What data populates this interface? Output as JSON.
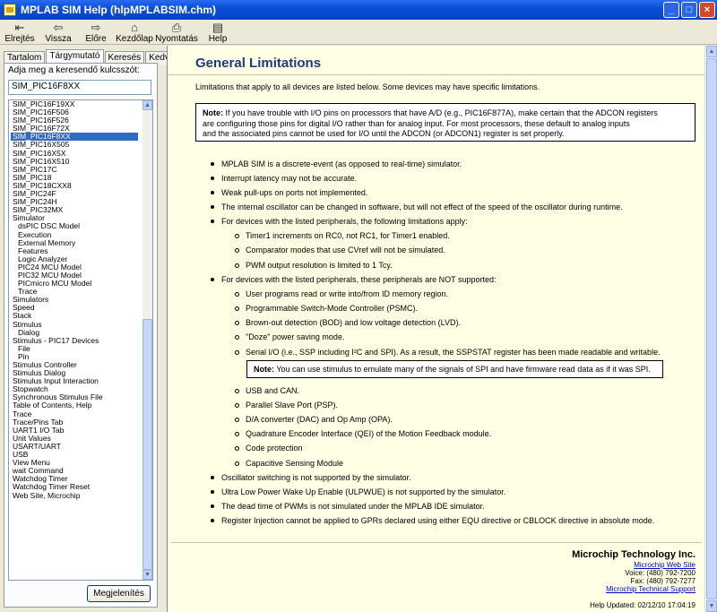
{
  "window": {
    "title": "MPLAB SIM Help (hlpMPLABSIM.chm)",
    "minimize": "_",
    "maximize": "□",
    "close": "×"
  },
  "toolbar": [
    {
      "label": "Elrejtés",
      "glyph": "⇤",
      "icon": "hide-icon"
    },
    {
      "label": "Vissza",
      "glyph": "⇦",
      "icon": "back-icon"
    },
    {
      "label": "Előre",
      "glyph": "⇨",
      "icon": "forward-icon"
    },
    {
      "label": "Kezdőlap",
      "glyph": "⌂",
      "icon": "home-icon"
    },
    {
      "label": "Nyomtatás",
      "glyph": "⎙",
      "icon": "print-icon"
    },
    {
      "label": "Help",
      "glyph": "▤",
      "icon": "help-icon"
    }
  ],
  "nav": {
    "tabs": [
      "Tartalom",
      "Tárgymutató",
      "Keresés",
      "Kedvencek"
    ],
    "active_tab": 1,
    "keyword_label": "Adja meg a keresendő kulcsszót:",
    "keyword_value": "SIM_PIC16F8XX",
    "show_button": "Megjelenítés",
    "index_items": [
      {
        "text": "SIM_PIC16F19XX",
        "level": 0
      },
      {
        "text": "SIM_PIC16F506",
        "level": 0
      },
      {
        "text": "SIM_PIC16F526",
        "level": 0
      },
      {
        "text": "SIM_PIC16F72X",
        "level": 0
      },
      {
        "text": "SIM_PIC16F8XX",
        "level": 0,
        "selected": true
      },
      {
        "text": "SIM_PIC16X505",
        "level": 0
      },
      {
        "text": "SIM_PIC16X5X",
        "level": 0
      },
      {
        "text": "SIM_PIC16X510",
        "level": 0
      },
      {
        "text": "SIM_PIC17C",
        "level": 0
      },
      {
        "text": "SIM_PIC18",
        "level": 0
      },
      {
        "text": "SIM_PIC18CXX8",
        "level": 0
      },
      {
        "text": "SIM_PIC24F",
        "level": 0
      },
      {
        "text": "SIM_PIC24H",
        "level": 0
      },
      {
        "text": "SIM_PIC32MX",
        "level": 0
      },
      {
        "text": "Simulator",
        "level": 0
      },
      {
        "text": "dsPIC DSC Model",
        "level": 1
      },
      {
        "text": "Execution",
        "level": 1
      },
      {
        "text": "External Memory",
        "level": 1
      },
      {
        "text": "Features",
        "level": 1
      },
      {
        "text": "Logic Analyzer",
        "level": 1
      },
      {
        "text": "PIC24 MCU Model",
        "level": 1
      },
      {
        "text": "PIC32 MCU Model",
        "level": 1
      },
      {
        "text": "PICmicro MCU Model",
        "level": 1
      },
      {
        "text": "Trace",
        "level": 1
      },
      {
        "text": "Simulators",
        "level": 0
      },
      {
        "text": "Speed",
        "level": 0
      },
      {
        "text": "Stack",
        "level": 0
      },
      {
        "text": "Stimulus",
        "level": 0
      },
      {
        "text": "Dialog",
        "level": 1
      },
      {
        "text": "Stimulus - PIC17 Devices",
        "level": 0
      },
      {
        "text": "File",
        "level": 1
      },
      {
        "text": "Pin",
        "level": 1
      },
      {
        "text": "Stimulus Controller",
        "level": 0
      },
      {
        "text": "Stimulus Dialog",
        "level": 0
      },
      {
        "text": "Stimulus Input Interaction",
        "level": 0
      },
      {
        "text": "Stopwatch",
        "level": 0
      },
      {
        "text": "Synchronous Stimulus File",
        "level": 0
      },
      {
        "text": "Table of Contents, Help",
        "level": 0
      },
      {
        "text": "Trace",
        "level": 0
      },
      {
        "text": "Trace/Pins Tab",
        "level": 0
      },
      {
        "text": "UART1 I/O Tab",
        "level": 0
      },
      {
        "text": "Unit Values",
        "level": 0
      },
      {
        "text": "USART/UART",
        "level": 0
      },
      {
        "text": "USB",
        "level": 0
      },
      {
        "text": "View Menu",
        "level": 0
      },
      {
        "text": "wait Command",
        "level": 0
      },
      {
        "text": "Watchdog Timer",
        "level": 0
      },
      {
        "text": "Watchdog Timer Reset",
        "level": 0
      },
      {
        "text": "Web Site, Microchip",
        "level": 0
      }
    ]
  },
  "page": {
    "title": "General Limitations",
    "intro": "Limitations that apply to all devices are listed below. Some devices may have specific limitations.",
    "note_label": "Note:",
    "note_lines": [
      "If you have trouble with I/O pins on processors that have A/D (e.g., PIC16F877A), make certain that the ADCON registers",
      "are configuring those pins for digital I/O rather than for analog input. For most processors, these default to analog inputs",
      "and the associated pins cannot be used for I/O until the ADCON (or ADCON1) register is set properly."
    ],
    "bullets_top": [
      "MPLAB SIM is a discrete-event (as opposed to real-time) simulator.",
      "Interrupt latency may not be accurate.",
      "Weak pull-ups on ports not implemented.",
      "The internal oscillator can be changed in software, but will not effect of the speed of the oscillator during runtime.",
      "For devices with the listed peripherals, the following limitations apply:"
    ],
    "sub_bullets_1": [
      "Timer1 increments on RC0, not RC1, for Timer1 enabled.",
      "Comparator modes that use CVref will not be simulated.",
      "PWM output resolution is limited to 1 Tcy."
    ],
    "bullet_not_supported": "For devices with the listed peripherals, these peripherals are NOT supported:",
    "sub_bullets_2a": [
      "User programs read or write into/from ID memory region.",
      "Programmable Switch-Mode Controller (PSMC).",
      "Brown-out detection (BOD) and low voltage detection (LVD).",
      "\"Doze\" power saving mode.",
      "Serial I/O (i.e., SSP including I²C and SPI). As a result, the SSPSTAT register has been made readable and writable."
    ],
    "note2_label": "Note:",
    "note2_text": "You can use stimulus to emulate many of the signals of SPI and have firmware read data as if it was SPI.",
    "sub_bullets_2b": [
      "USB and CAN.",
      "Parallel Slave Port (PSP).",
      "D/A converter (DAC) and Op Amp (OPA).",
      "Quadrature Encoder Interface (QEI) of the Motion Feedback module.",
      "Code protection",
      "Capacitive Sensing Module"
    ],
    "bullets_bottom": [
      "Oscillator switching is not supported by the simulator.",
      "Ultra Low Power Wake Up Enable (ULPWUE) is not supported by the simulator.",
      "The dead time of PWMs is not simulated under the MPLAB IDE simulator.",
      "Register Injection cannot be applied to GPRs declared using either EQU directive or CBLOCK directive in absolute mode."
    ]
  },
  "footer": {
    "company": "Microchip Technology Inc.",
    "web_site": "Microchip Web Site",
    "voice": "Voice: (480) 792-7200",
    "fax": "Fax: (480) 792-7277",
    "support": "Microchip Technical Support",
    "updated": "Help Updated: 02/12/10 17:04:19"
  }
}
